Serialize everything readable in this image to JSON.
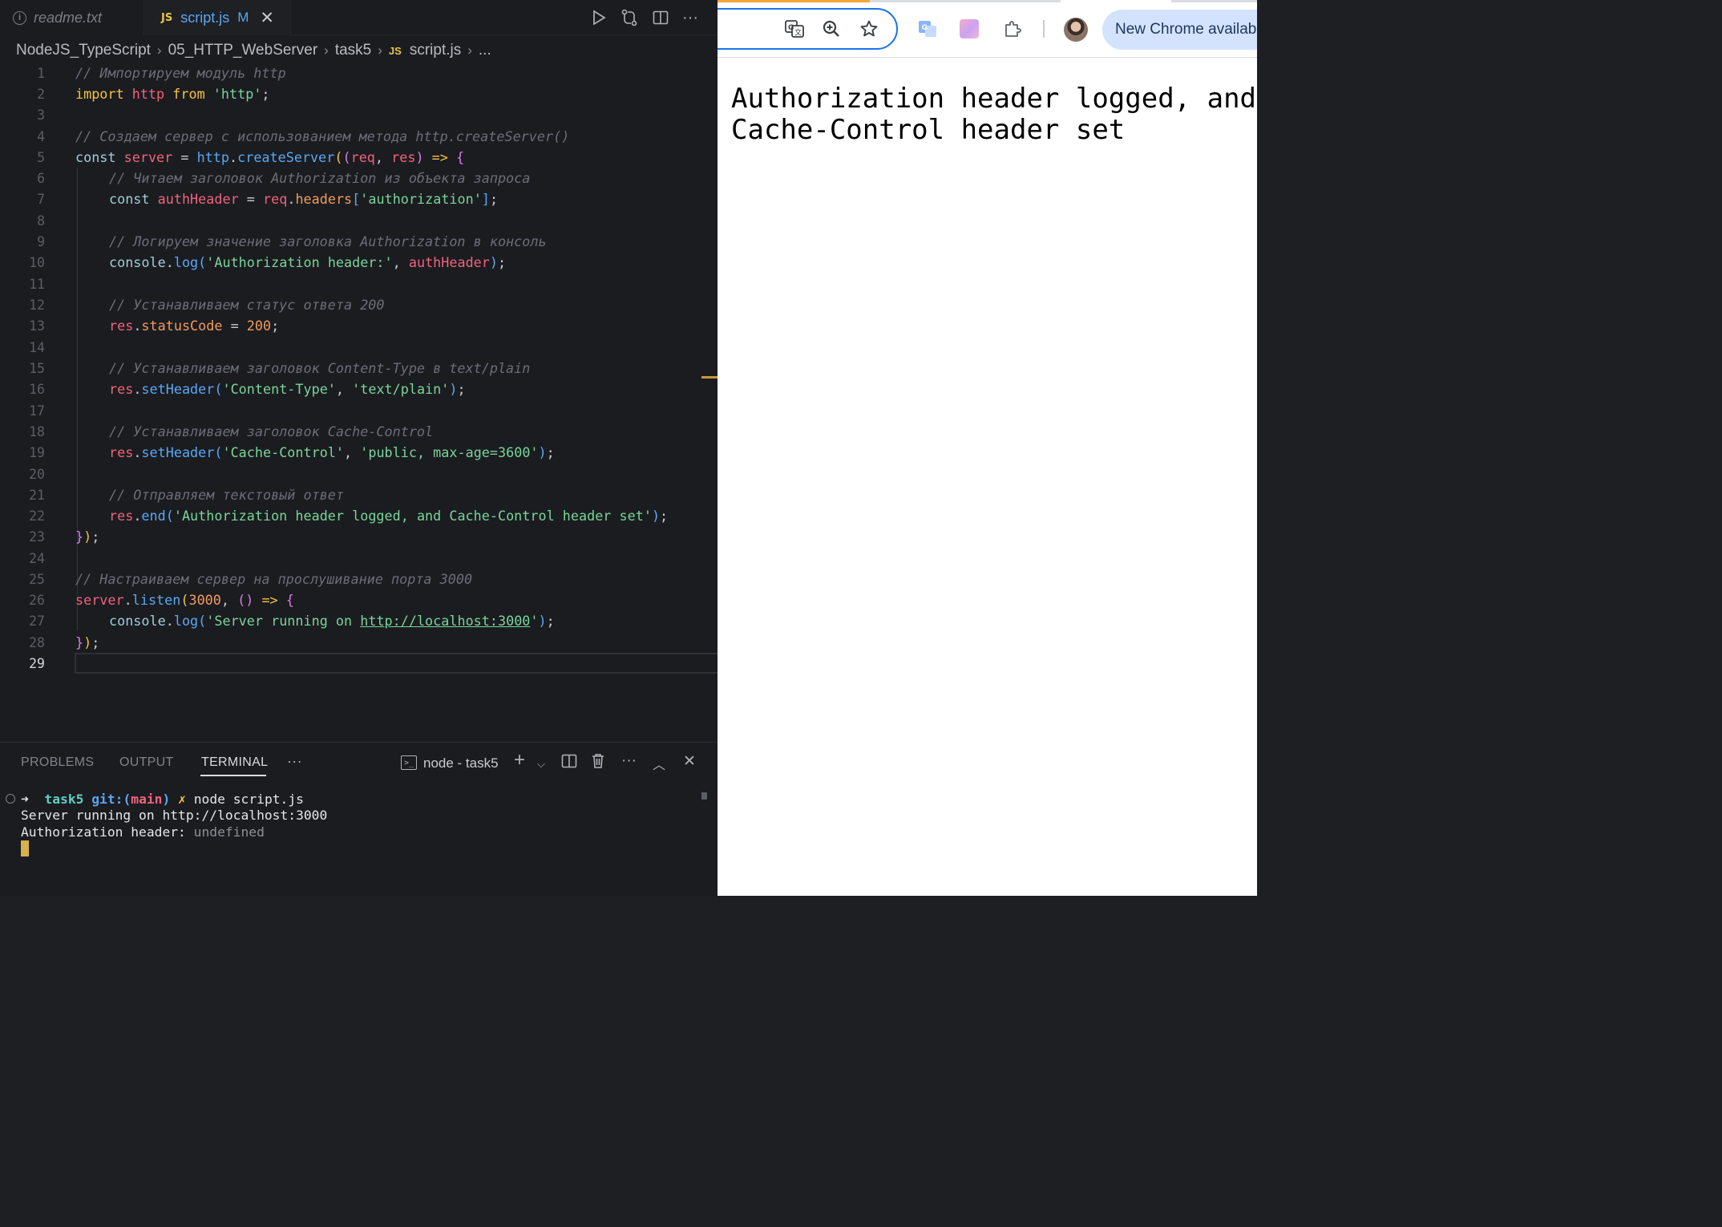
{
  "editor": {
    "tabs": [
      {
        "label": "readme.txt"
      },
      {
        "label": "script.js",
        "badge": "JS",
        "modified": "M"
      }
    ],
    "breadcrumb": [
      "NodeJS_TypeScript",
      "05_HTTP_WebServer",
      "task5",
      "script.js",
      "..."
    ],
    "breadcrumb_js_badge": "JS",
    "active_line": 29,
    "line_numbers": [
      "1",
      "2",
      "3",
      "4",
      "5",
      "6",
      "7",
      "8",
      "9",
      "10",
      "11",
      "12",
      "13",
      "14",
      "15",
      "16",
      "17",
      "18",
      "19",
      "20",
      "21",
      "22",
      "23",
      "24",
      "25",
      "26",
      "27",
      "28",
      "29"
    ],
    "code": {
      "l1": "// Импортируем модуль http",
      "l2_kw": "import",
      "l2_id": "http",
      "l2_from": "from",
      "l2_str": "'http'",
      "l4": "// Создаем сервер с использованием метода http.createServer()",
      "l5_const": "const",
      "l5_var": "server",
      "l5_obj": "http",
      "l5_fn": "createServer",
      "l5_p1": "req",
      "l5_p2": "res",
      "l6": "// Читаем заголовок Authorization из объекта запроса",
      "l7_const": "const",
      "l7_var": "authHeader",
      "l7_obj": "req",
      "l7_prop": "headers",
      "l7_str": "'authorization'",
      "l9": "// Логируем значение заголовка Authorization в консоль",
      "l10_obj": "console",
      "l10_fn": "log",
      "l10_str": "'Authorization header:'",
      "l10_var": "authHeader",
      "l12": "// Устанавливаем статус ответа 200",
      "l13_obj": "res",
      "l13_prop": "statusCode",
      "l13_num": "200",
      "l15": "// Устанавливаем заголовок Content-Type в text/plain",
      "l16_obj": "res",
      "l16_fn": "setHeader",
      "l16_s1": "'Content-Type'",
      "l16_s2": "'text/plain'",
      "l18": "// Устанавливаем заголовок Cache-Control",
      "l19_obj": "res",
      "l19_fn": "setHeader",
      "l19_s1": "'Cache-Control'",
      "l19_s2": "'public, max-age=3600'",
      "l21": "// Отправляем текстовый ответ",
      "l22_obj": "res",
      "l22_fn": "end",
      "l22_str": "'Authorization header logged, and Cache-Control header set'",
      "l25": "// Настраиваем сервер на прослушивание порта 3000",
      "l26_obj": "server",
      "l26_fn": "listen",
      "l26_num": "3000",
      "l27_obj": "console",
      "l27_fn": "log",
      "l27_str_a": "'Server running on ",
      "l27_url": "http://localhost:3000",
      "l27_str_b": "'"
    }
  },
  "panel": {
    "tabs": [
      "PROBLEMS",
      "OUTPUT",
      "TERMINAL"
    ],
    "more": "···",
    "terminal_name": "node - task5",
    "terminal_lines": {
      "prompt_arrow": "➜",
      "dir": "task5",
      "git": "git:(",
      "branch": "main",
      "git_close": ")",
      "dirty": "✗",
      "command": "node script.js",
      "out1": "Server running on http://localhost:3000",
      "out2_label": "Authorization header: ",
      "out2_value": "undefined"
    }
  },
  "browser": {
    "update_button": "New Chrome available",
    "page_text_line1": "Authorization header logged, and",
    "page_text_line2": "Cache-Control header set",
    "colors": {
      "omnibox_border": "#1a73e8",
      "update_pill": "#d3e3fd",
      "loading": "#f4a53c"
    }
  }
}
